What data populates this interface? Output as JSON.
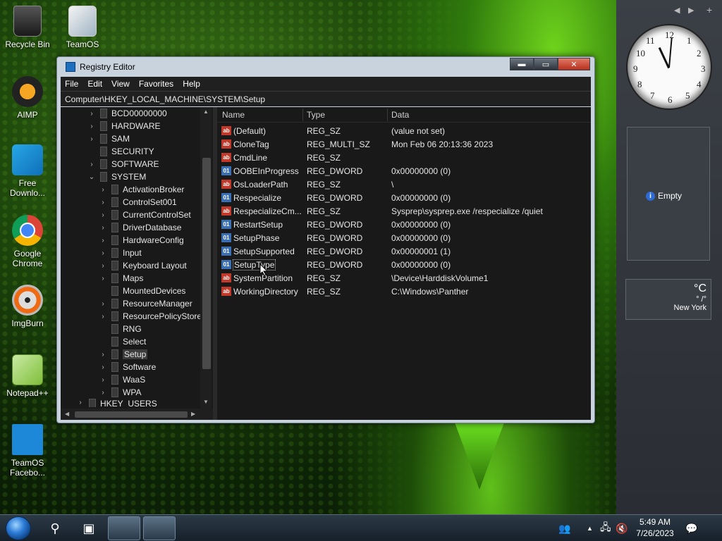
{
  "desktop": {
    "icons": [
      {
        "label": "Recycle Bin"
      },
      {
        "label": "TeamOS"
      },
      {
        "label": "AIMP"
      },
      {
        "label": "Free Downlo..."
      },
      {
        "label": "Google Chrome"
      },
      {
        "label": "ImgBurn"
      },
      {
        "label": "Notepad++"
      },
      {
        "label": "TeamOS Facebo..."
      }
    ]
  },
  "gadgets": {
    "prev": "◀",
    "next": "▶",
    "add": "+",
    "clock_numbers": [
      "12",
      "1",
      "2",
      "3",
      "4",
      "5",
      "6",
      "7",
      "8",
      "9",
      "10",
      "11"
    ],
    "slideshow_text": "Empty",
    "info_glyph": "i",
    "weather": {
      "deg": "°C",
      "range": "° /°",
      "city": "New York"
    }
  },
  "window": {
    "title": "Registry Editor",
    "minimize": "▬",
    "maximize": "▭",
    "close": "✕",
    "menu": [
      "File",
      "Edit",
      "View",
      "Favorites",
      "Help"
    ],
    "address": "Computer\\HKEY_LOCAL_MACHINE\\SYSTEM\\Setup"
  },
  "tree": {
    "scroll_up": "▲",
    "scroll_down": "▼",
    "scroll_left": "◀",
    "scroll_right": "▶",
    "items": [
      {
        "label": "BCD00000000",
        "chev": "›"
      },
      {
        "label": "HARDWARE",
        "chev": "›"
      },
      {
        "label": "SAM",
        "chev": "›"
      },
      {
        "label": "SECURITY",
        "chev": ""
      },
      {
        "label": "SOFTWARE",
        "chev": "›"
      },
      {
        "label": "SYSTEM",
        "chev": "⌄"
      },
      {
        "label": "ActivationBroker",
        "chev": "›"
      },
      {
        "label": "ControlSet001",
        "chev": "›"
      },
      {
        "label": "CurrentControlSet",
        "chev": "›"
      },
      {
        "label": "DriverDatabase",
        "chev": "›"
      },
      {
        "label": "HardwareConfig",
        "chev": "›"
      },
      {
        "label": "Input",
        "chev": "›"
      },
      {
        "label": "Keyboard Layout",
        "chev": "›"
      },
      {
        "label": "Maps",
        "chev": "›"
      },
      {
        "label": "MountedDevices",
        "chev": ""
      },
      {
        "label": "ResourceManager",
        "chev": "›"
      },
      {
        "label": "ResourcePolicyStore",
        "chev": "›"
      },
      {
        "label": "RNG",
        "chev": ""
      },
      {
        "label": "Select",
        "chev": ""
      },
      {
        "label": "Setup",
        "chev": "›"
      },
      {
        "label": "Software",
        "chev": "›"
      },
      {
        "label": "WaaS",
        "chev": "›"
      },
      {
        "label": "WPA",
        "chev": "›"
      },
      {
        "label": "HKEY_USERS",
        "chev": "›"
      }
    ]
  },
  "list": {
    "headers": {
      "name": "Name",
      "type": "Type",
      "data": "Data"
    },
    "rows": [
      {
        "icon": "ab",
        "name": "(Default)",
        "type": "REG_SZ",
        "data": "(value not set)"
      },
      {
        "icon": "ab",
        "name": "CloneTag",
        "type": "REG_MULTI_SZ",
        "data": "Mon Feb 06 20:13:36 2023"
      },
      {
        "icon": "ab",
        "name": "CmdLine",
        "type": "REG_SZ",
        "data": ""
      },
      {
        "icon": "01",
        "name": "OOBEInProgress",
        "type": "REG_DWORD",
        "data": "0x00000000 (0)"
      },
      {
        "icon": "ab",
        "name": "OsLoaderPath",
        "type": "REG_SZ",
        "data": "\\"
      },
      {
        "icon": "01",
        "name": "Respecialize",
        "type": "REG_DWORD",
        "data": "0x00000000 (0)"
      },
      {
        "icon": "ab",
        "name": "RespecializeCm...",
        "type": "REG_SZ",
        "data": "Sysprep\\sysprep.exe /respecialize /quiet"
      },
      {
        "icon": "01",
        "name": "RestartSetup",
        "type": "REG_DWORD",
        "data": "0x00000000 (0)"
      },
      {
        "icon": "01",
        "name": "SetupPhase",
        "type": "REG_DWORD",
        "data": "0x00000000 (0)"
      },
      {
        "icon": "01",
        "name": "SetupSupported",
        "type": "REG_DWORD",
        "data": "0x00000001 (1)"
      },
      {
        "icon": "01",
        "name": "SetupType",
        "type": "REG_DWORD",
        "data": "0x00000000 (0)"
      },
      {
        "icon": "ab",
        "name": "SystemPartition",
        "type": "REG_SZ",
        "data": "\\Device\\HarddiskVolume1"
      },
      {
        "icon": "ab",
        "name": "WorkingDirectory",
        "type": "REG_SZ",
        "data": "C:\\Windows\\Panther"
      }
    ]
  },
  "taskbar": {
    "search_glyph": "⚲",
    "taskview_glyph": "▣",
    "tray_people": "👥",
    "tray_arrow": "▲",
    "tray_network": "🖧",
    "tray_volume": "🔇",
    "notif_glyph": "💬",
    "time": "5:49 AM",
    "date": "7/26/2023"
  }
}
